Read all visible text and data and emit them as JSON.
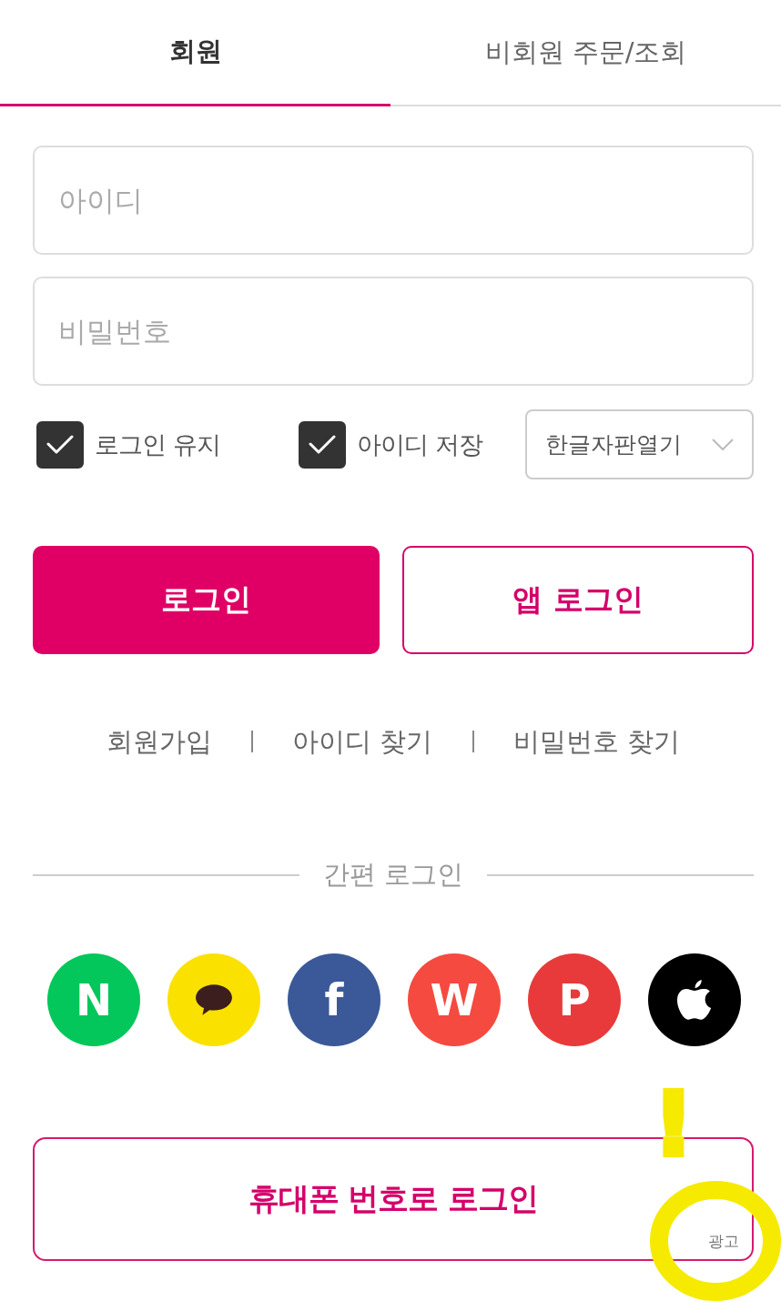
{
  "tabs": [
    {
      "label": "회원",
      "selected": true
    },
    {
      "label": "비회원 주문/조회",
      "selected": false
    }
  ],
  "login_form": {
    "fields": [
      {
        "placeholder": "아이디"
      },
      {
        "placeholder": "비밀번호"
      }
    ],
    "options": [
      {
        "label": "로그인 유지",
        "checked": true
      },
      {
        "label": "아이디 저장",
        "checked": true
      }
    ],
    "keyboard_select": {
      "value": "한글자판열기"
    },
    "buttons": [
      {
        "kind": "primary",
        "label": "로그인"
      },
      {
        "kind": "outline",
        "label": "앱 로그인"
      }
    ]
  },
  "account_links": [
    "회원가입",
    "아이디 찾기",
    "비밀번호 찾기"
  ],
  "easy_login": {
    "title": "간편 로그인",
    "providers": [
      {
        "kind": "letter",
        "label": "N",
        "color": "#03c75a"
      },
      {
        "kind": "bubble",
        "color": "#fae100"
      },
      {
        "kind": "letter",
        "label": "f",
        "color": "#3b5998"
      },
      {
        "kind": "letter",
        "label": "W",
        "color": "#f54a40"
      },
      {
        "kind": "letter",
        "label": "P",
        "color": "#e83a3a"
      },
      {
        "kind": "apple",
        "color": "#000000"
      }
    ]
  },
  "phone_login": {
    "label": "휴대폰 번호로 로그인",
    "ad_label": "광고"
  },
  "annotation": {
    "mark": "!"
  }
}
